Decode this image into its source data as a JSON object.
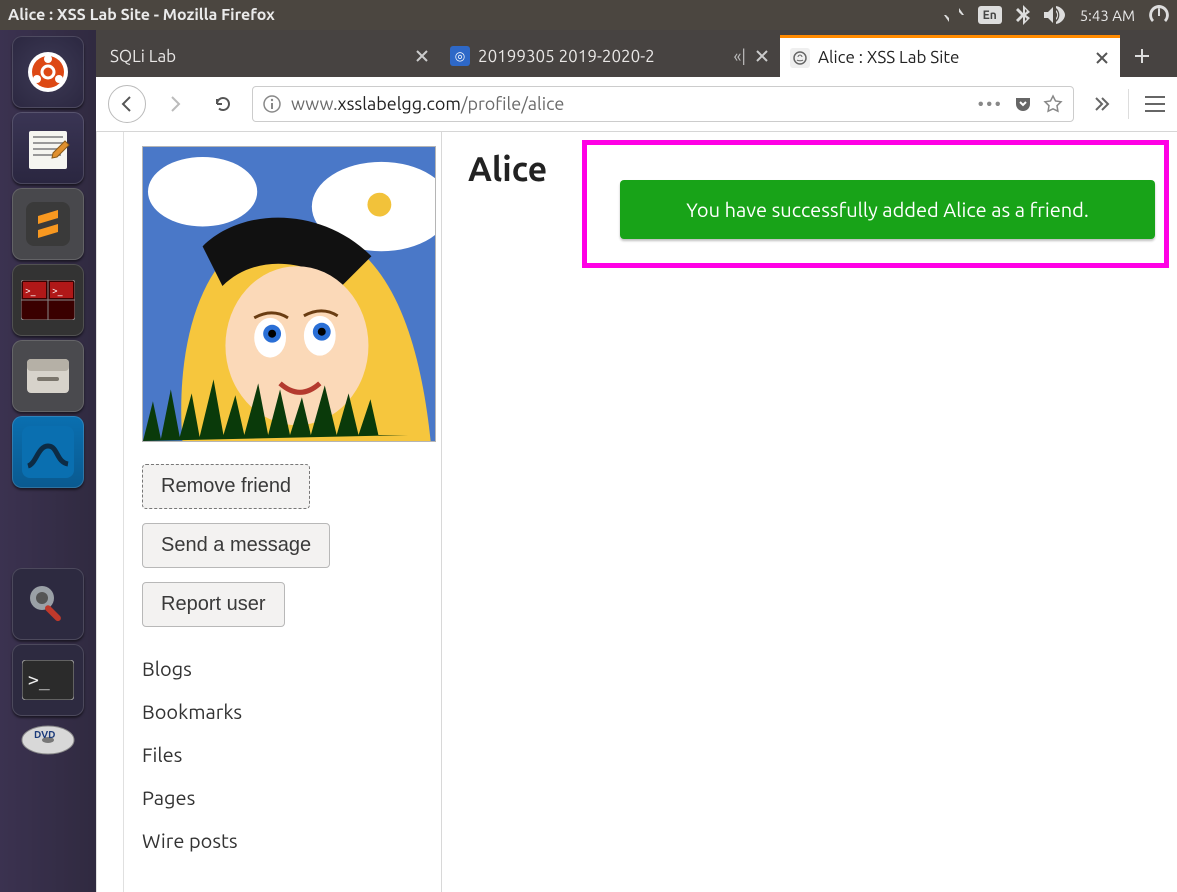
{
  "os": {
    "window_title": "Alice : XSS Lab Site - Mozilla Firefox",
    "lang_indicator": "En",
    "clock": "5:43 AM"
  },
  "launcher": {
    "items": [
      {
        "name": "ubuntu-dash"
      },
      {
        "name": "text-editor"
      },
      {
        "name": "sublime-text"
      },
      {
        "name": "terminal-red"
      },
      {
        "name": "file-manager"
      },
      {
        "name": "wireshark"
      },
      {
        "name": "firefox"
      },
      {
        "name": "settings"
      },
      {
        "name": "terminal"
      },
      {
        "name": "disc-media"
      }
    ]
  },
  "browser": {
    "tabs": [
      {
        "label": "SQLi Lab",
        "active": false
      },
      {
        "label": "20199305 2019-2020-2",
        "active": false
      },
      {
        "label": "Alice : XSS Lab Site",
        "active": true
      }
    ],
    "url_pre": "www.",
    "url_host": "xsslabelgg.com",
    "url_path": "/profile/alice"
  },
  "profile": {
    "name": "Alice",
    "actions": {
      "remove_friend": "Remove friend",
      "send_message": "Send a message",
      "report_user": "Report user"
    },
    "links": [
      "Blogs",
      "Bookmarks",
      "Files",
      "Pages",
      "Wire posts"
    ],
    "success_message": "You have successfully added Alice as a friend."
  }
}
